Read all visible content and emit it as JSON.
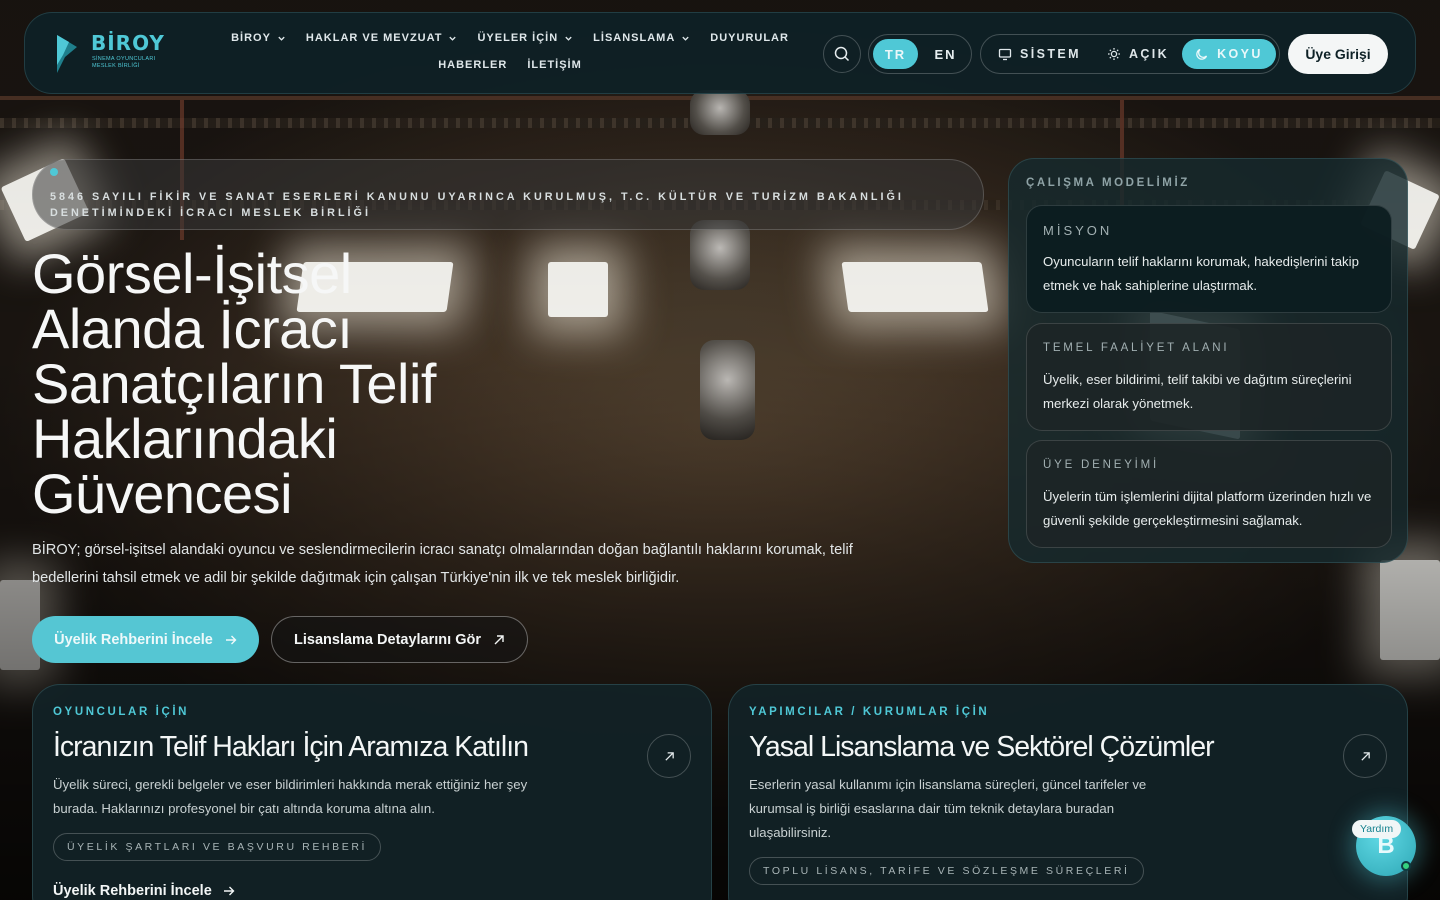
{
  "header": {
    "logo": {
      "name": "BİROY",
      "subtitle": "SİNEMA OYUNCULARI MESLEK BİRLİĞİ"
    },
    "nav": {
      "row1": [
        {
          "label": "BİROY",
          "dropdown": true
        },
        {
          "label": "HAKLAR VE MEVZUAT",
          "dropdown": true
        },
        {
          "label": "ÜYELER İÇİN",
          "dropdown": true
        },
        {
          "label": "LİSANSLAMA",
          "dropdown": true
        },
        {
          "label": "DUYURULAR",
          "dropdown": false
        }
      ],
      "row2": [
        {
          "label": "HABERLER"
        },
        {
          "label": "İLETİŞİM"
        }
      ]
    },
    "lang": {
      "tr": "TR",
      "en": "EN",
      "active": "TR"
    },
    "theme": {
      "system": "SİSTEM",
      "light": "AÇIK",
      "dark": "KOYU",
      "active": "KOYU"
    },
    "login_label": "Üye Girişi"
  },
  "hero": {
    "badge": "5846 SAYILI FİKİR VE SANAT ESERLERİ KANUNU UYARINCA KURULMUŞ, T.C. KÜLTÜR VE TURİZM BAKANLIĞI DENETİMİNDEKİ İCRACI MESLEK BİRLİĞİ",
    "title": "Görsel-İşitsel Alanda İcracı Sanatçıların Telif Haklarındaki Güvencesi",
    "description": "BİROY; görsel-işitsel alandaki oyuncu ve seslendirmecilerin icracı sanatçı olmalarından doğan bağlantılı haklarını korumak, telif bedellerini tahsil etmek ve adil bir şekilde dağıtmak için çalışan Türkiye'nin ilk ve tek meslek birliğidir.",
    "primary_button": "Üyelik Rehberini İncele",
    "secondary_button": "Lisanslama Detaylarını Gör"
  },
  "model": {
    "heading": "ÇALIŞMA MODELİMİZ",
    "cards": [
      {
        "title": "MİSYON",
        "text": "Oyuncuların telif haklarını korumak, hakedişlerini takip etmek ve hak sahiplerine ulaştırmak."
      },
      {
        "title": "TEMEL FAALİYET ALANI",
        "text": "Üyelik, eser bildirimi, telif takibi ve dağıtım süreçlerini merkezi olarak yönetmek."
      },
      {
        "title": "ÜYE DENEYİMİ",
        "text": "Üyelerin tüm işlemlerini dijital platform üzerinden hızlı ve güvenli şekilde gerçekleştirmesini sağlamak."
      }
    ]
  },
  "cards": [
    {
      "eyebrow": "OYUNCULAR İÇİN",
      "title": "İcranızın Telif Hakları İçin Aramıza Katılın",
      "description": "Üyelik süreci, gerekli belgeler ve eser bildirimleri hakkında merak ettiğiniz her şey burada. Haklarınızı profesyonel bir çatı altında koruma altına alın.",
      "tag": "ÜYELİK ŞARTLARI VE BAŞVURU REHBERİ",
      "link": "Üyelik Rehberini İncele"
    },
    {
      "eyebrow": "YAPIMCILAR / KURUMLAR İÇİN",
      "title": "Yasal Lisanslama ve Sektörel Çözümler",
      "description": "Eserlerin yasal kullanımı için lisanslama süreçleri, güncel tarifeler ve kurumsal iş birliği esaslarına dair tüm teknik detaylara buradan ulaşabilirsiniz.",
      "tag": "TOPLU LİSANS, TARİFE VE SÖZLEŞME SÜREÇLERİ"
    }
  ],
  "help": {
    "label": "Yardım",
    "letter": "B"
  },
  "colors": {
    "accent": "#4fc8d6",
    "header_bg": "#0e2126",
    "card_bg": "#122226",
    "online": "#35d07f"
  }
}
